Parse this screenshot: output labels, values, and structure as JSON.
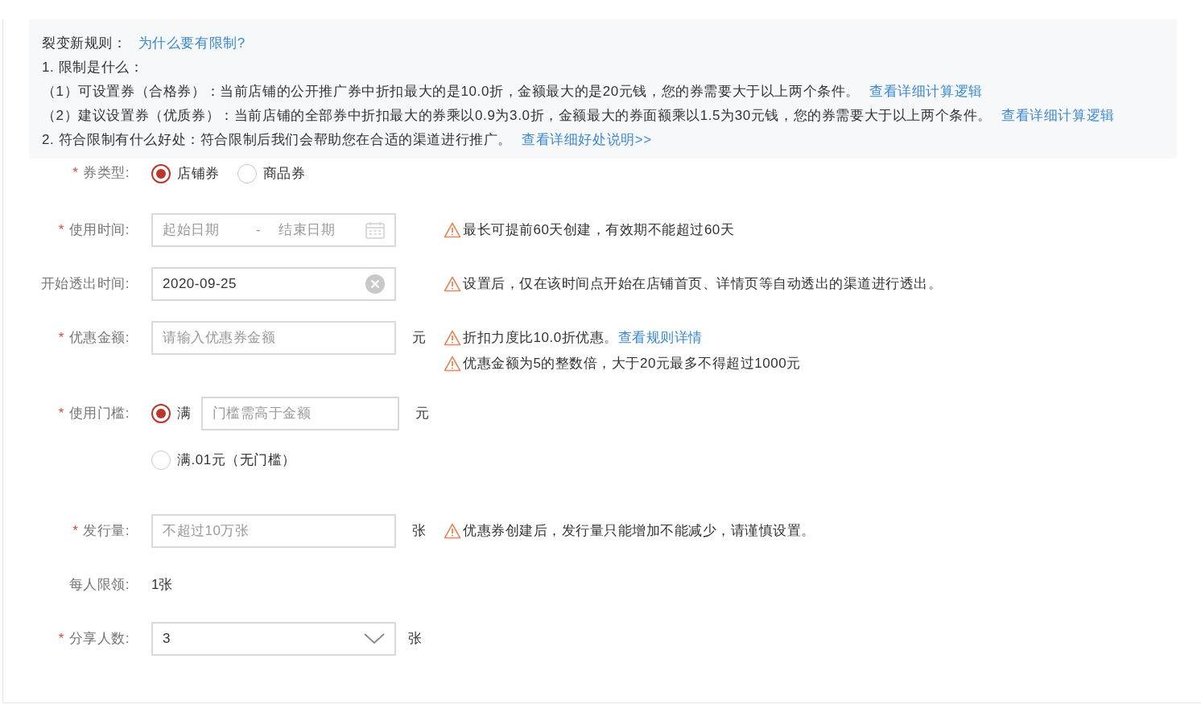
{
  "notice": {
    "title": "裂变新规则：",
    "title_link": "为什么要有限制?",
    "lines": [
      {
        "text": "1. 限制是什么："
      },
      {
        "text": "（1）可设置券（合格券）：当前店铺的公开推广券中折扣最大的是10.0折，金额最大的是20元钱，您的券需要大于以上两个条件。",
        "link": "查看详细计算逻辑"
      },
      {
        "text": "（2）建议设置券（优质券）：当前店铺的全部券中折扣最大的券乘以0.9为3.0折，金额最大的券面额乘以1.5为30元钱，您的券需要大于以上两个条件。",
        "link": "查看详细计算逻辑"
      },
      {
        "text": "2. 符合限制有什么好处：符合限制后我们会帮助您在合适的渠道进行推广。",
        "link": "查看详细好处说明>>"
      }
    ]
  },
  "fields": [
    {
      "kind": "radio",
      "required_mark": "*",
      "label": "券类型:",
      "options": [
        {
          "label": "店铺券",
          "selected": true
        },
        {
          "label": "商品券",
          "selected": false
        }
      ]
    },
    {
      "kind": "date_range",
      "required_mark": "*",
      "label": "使用时间:",
      "start_placeholder": "起始日期",
      "separator": "-",
      "end_placeholder": "结束日期",
      "tips": [
        {
          "text": "最长可提前60天创建，有效期不能超过60天"
        }
      ]
    },
    {
      "kind": "clearable_input",
      "label": "开始透出时间:",
      "value": "2020-09-25",
      "tips": [
        {
          "text": "设置后，仅在该时间点开始在店铺首页、详情页等自动透出的渠道进行透出。"
        }
      ]
    },
    {
      "kind": "input",
      "required_mark": "*",
      "label": "优惠金额:",
      "placeholder": "请输入优惠券金额",
      "unit": "元",
      "tips": [
        {
          "text": "折扣力度比10.0折优惠。",
          "link": "查看规则详情"
        },
        {
          "text": "优惠金额为5的整数倍，大于20元最多不得超过1000元"
        }
      ]
    },
    {
      "kind": "threshold",
      "required_mark": "*",
      "label": "使用门槛:",
      "options": [
        {
          "label": "满",
          "selected": true,
          "placeholder": "门槛需高于金额",
          "unit": "元"
        },
        {
          "label": "满.01元（无门槛）",
          "selected": false
        }
      ]
    },
    {
      "kind": "input",
      "required_mark": "*",
      "label": "发行量:",
      "placeholder": "不超过10万张",
      "unit": "张",
      "tips": [
        {
          "text": "优惠券创建后，发行量只能增加不能减少，请谨慎设置。"
        }
      ]
    },
    {
      "kind": "static",
      "label": "每人限领:",
      "value": "1张"
    },
    {
      "kind": "select",
      "required_mark": "*",
      "label": "分享人数:",
      "value": "3",
      "unit": "张"
    }
  ]
}
